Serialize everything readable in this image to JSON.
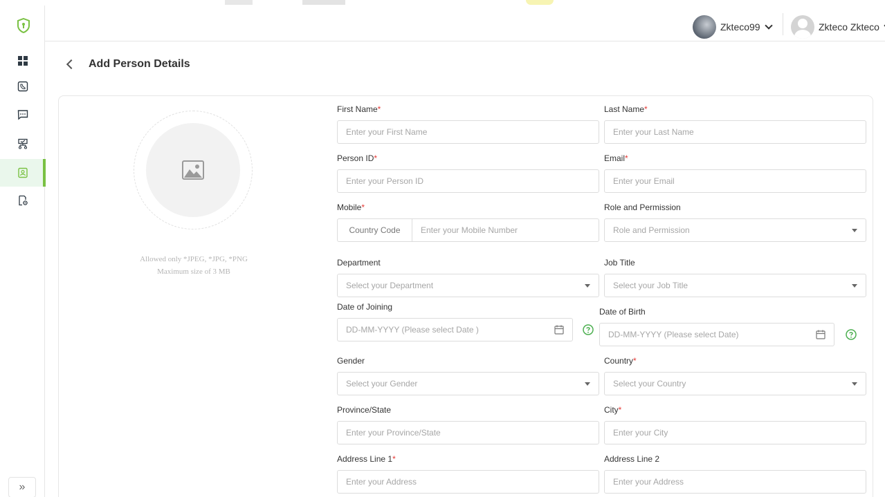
{
  "header": {
    "company_name": "Zkteco99",
    "user_name": "Zkteco Zkteco"
  },
  "page": {
    "title": "Add Person Details"
  },
  "photo": {
    "hint_line1": "Allowed only *JPEG, *JPG, *PNG",
    "hint_line2": "Maximum size of 3 MB"
  },
  "form": {
    "first_name": {
      "label": "First Name",
      "required": "*",
      "placeholder": "Enter your First Name"
    },
    "last_name": {
      "label": "Last Name",
      "required": "*",
      "placeholder": "Enter your Last Name"
    },
    "person_id": {
      "label": "Person ID",
      "required": "*",
      "placeholder": "Enter your Person ID"
    },
    "email": {
      "label": "Email",
      "required": "*",
      "placeholder": "Enter your Email"
    },
    "mobile": {
      "label": "Mobile",
      "required": "*",
      "country_code": "Country Code",
      "placeholder": "Enter your Mobile Number"
    },
    "role": {
      "label": "Role and Permission",
      "placeholder": "Role and Permission"
    },
    "department": {
      "label": "Department",
      "placeholder": "Select your Department"
    },
    "job_title": {
      "label": "Job Title",
      "placeholder": "Select your Job Title"
    },
    "date_of_joining": {
      "label": "Date of Joining",
      "placeholder": "DD-MM-YYYY (Please select Date )"
    },
    "date_of_birth": {
      "label": "Date of Birth",
      "placeholder": "DD-MM-YYYY (Please select Date)"
    },
    "gender": {
      "label": "Gender",
      "placeholder": "Select your Gender"
    },
    "country": {
      "label": "Country",
      "required": "*",
      "placeholder": "Select your Country"
    },
    "province": {
      "label": "Province/State",
      "placeholder": "Enter your Province/State"
    },
    "city": {
      "label": "City",
      "required": "*",
      "placeholder": "Enter your City"
    },
    "address1": {
      "label": "Address Line 1",
      "required": "*",
      "placeholder": "Enter your Address"
    },
    "address2": {
      "label": "Address Line 2",
      "placeholder": "Enter your Address"
    }
  },
  "sidebar": {
    "items": [
      {
        "icon": "dashboard-icon"
      },
      {
        "icon": "device-icon"
      },
      {
        "icon": "message-icon"
      },
      {
        "icon": "organization-icon"
      },
      {
        "icon": "person-card-icon",
        "active": true
      },
      {
        "icon": "settings-icon"
      }
    ],
    "collapse_label": "»"
  },
  "colors": {
    "accent": "#7ac143",
    "required": "#e53935",
    "help": "#4caf50"
  }
}
